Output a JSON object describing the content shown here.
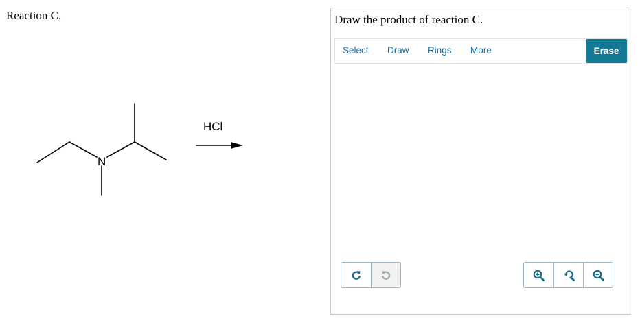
{
  "question": {
    "title": "Reaction C."
  },
  "reaction": {
    "nitrogen_label": "N",
    "reagent": "HCl"
  },
  "drawing_panel": {
    "prompt": "Draw the product of reaction C.",
    "toolbar": {
      "tabs": [
        "Select",
        "Draw",
        "Rings",
        "More"
      ],
      "erase_label": "Erase"
    },
    "controls": {
      "undo_icon": "undo-icon",
      "redo_icon": "redo-icon",
      "zoom_in_icon": "zoom-in-icon",
      "reset_zoom_icon": "reset-zoom-icon",
      "zoom_out_icon": "zoom-out-icon"
    },
    "accent_color": "#147a96",
    "icon_color": "#1a6f8a"
  }
}
